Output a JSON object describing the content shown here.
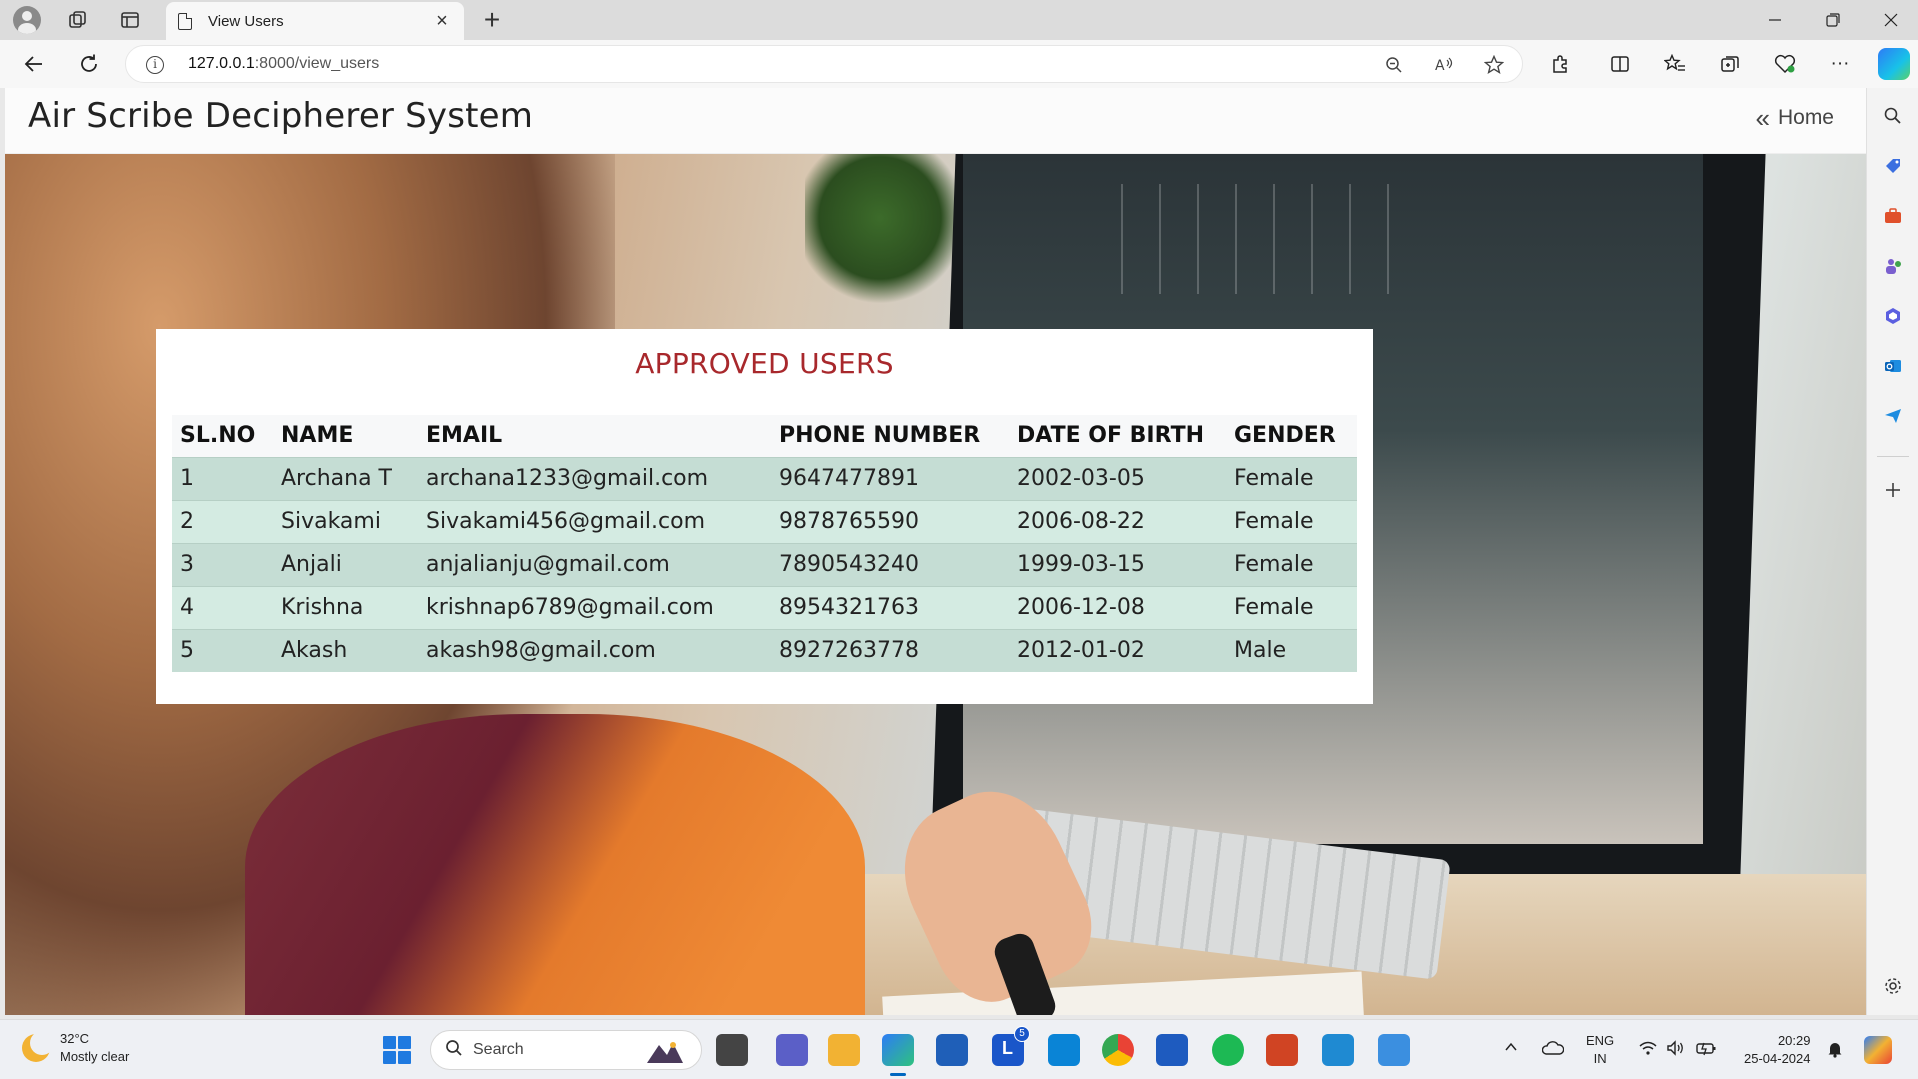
{
  "browser": {
    "tab_title": "View Users",
    "url_host": "127.0.0.1",
    "url_rest": ":8000/view_users"
  },
  "header": {
    "site_title": "Air Scribe Decipherer System",
    "home_label": "Home"
  },
  "card": {
    "title": "APPROVED USERS",
    "columns": [
      "SL.NO",
      "NAME",
      "EMAIL",
      "PHONE NUMBER",
      "DATE OF BIRTH",
      "GENDER"
    ],
    "rows": [
      [
        "1",
        "Archana T",
        "archana1233@gmail.com",
        "9647477891",
        "2002-03-05",
        "Female"
      ],
      [
        "2",
        "Sivakami",
        "Sivakami456@gmail.com",
        "9878765590",
        "2006-08-22",
        "Female"
      ],
      [
        "3",
        "Anjali",
        "anjalianju@gmail.com",
        "7890543240",
        "1999-03-15",
        "Female"
      ],
      [
        "4",
        "Krishna",
        "krishnap6789@gmail.com",
        "8954321763",
        "2006-12-08",
        "Female"
      ],
      [
        "5",
        "Akash",
        "akash98@gmail.com",
        "8927263778",
        "2012-01-02",
        "Male"
      ]
    ]
  },
  "taskbar": {
    "weather_temp": "32°C",
    "weather_desc": "Mostly clear",
    "search_placeholder": "Search",
    "lang_top": "ENG",
    "lang_bottom": "IN",
    "time": "20:29",
    "date": "25-04-2024",
    "badge_count": "5"
  },
  "colors": {
    "accent_title": "#a8282c",
    "row_odd": "#c5ddd4",
    "row_even": "#d4ebe2"
  },
  "icons": [
    "profile-icon",
    "workspaces-icon",
    "tab-actions-icon",
    "document-icon",
    "close-icon",
    "plus-icon",
    "back-icon",
    "refresh-icon",
    "info-icon",
    "zoom-icon",
    "read-aloud-icon",
    "favorite-star-icon",
    "extensions-icon",
    "split-screen-icon",
    "favorites-icon",
    "collections-icon",
    "browser-essentials-icon",
    "more-icon",
    "copilot-icon",
    "chevron-double-left-icon"
  ]
}
